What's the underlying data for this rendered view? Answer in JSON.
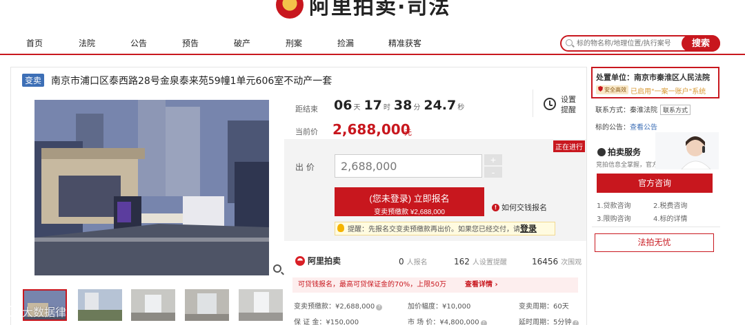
{
  "header": {
    "logo_text": "阿里拍卖·司法",
    "nav": [
      "首页",
      "法院",
      "公告",
      "预告",
      "破产",
      "刑案",
      "捡漏",
      "精准获客"
    ],
    "search_placeholder": "标的物名称/地理位置/执行案号",
    "search_button": "搜索"
  },
  "item": {
    "tag": "变卖",
    "title": "南京市浦口区泰西路28号金泉泰来苑59幢1单元606室不动产一套",
    "countdown_label": "距结束",
    "countdown": {
      "days": "06",
      "days_unit": "天",
      "hours": "17",
      "hours_unit": "时",
      "minutes": "38",
      "minutes_unit": "分",
      "seconds": "24.7",
      "seconds_unit": "秒"
    },
    "current_price_label": "当前价",
    "current_price": "2,688,000",
    "price_unit": "元",
    "remind": "设置提醒",
    "status": "正在进行",
    "bid_label": "出 价",
    "bid_value": "2,688,000",
    "plus": "+",
    "minus": "-",
    "signup_line1": "(您未登录) 立即报名",
    "signup_line2": "变卖预缴款 ¥2,688,000",
    "howto": "如何交钱报名",
    "tip_text": "提醒：先报名交变卖预缴款再出价。如果您已经交付，请",
    "tip_link": "登录"
  },
  "stats": {
    "brand": "阿里拍卖",
    "signups": "0",
    "signups_unit": "人报名",
    "reminders": "162",
    "reminders_unit": "人设置提醒",
    "views": "16456",
    "views_unit": "次围观"
  },
  "deposit_banner": {
    "text": "可贷钱报名，最高可贷保证金的70%，上限50万",
    "link": "查看详情 ›"
  },
  "details": [
    {
      "label": "变卖预缴款：¥2,688,000",
      "q": true
    },
    {
      "label": "加价幅度：¥10,000",
      "q": false
    },
    {
      "label": "变卖周期：60天",
      "q": false
    },
    {
      "label": "保 证 金：¥150,000",
      "q": false
    },
    {
      "label": "市 场 价：¥4,800,000",
      "q": true
    },
    {
      "label": "延时周期：5分钟",
      "q": true
    }
  ],
  "sidebar": {
    "court_label": "处置单位：南京市秦淮区人民法院",
    "safety_badge": "安全高效",
    "court_account": "已启用\"一案一账户\"系统",
    "contact": "联系方式：秦淮法院",
    "contact_btn": "联系方式",
    "notice_label": "标的公告：",
    "notice_link": "查看公告",
    "service_title": "拍卖服务",
    "service_sub": "竞拍信息全掌握，官方服务更放心",
    "consult_btn": "官方咨询",
    "links": [
      "1.贷款咨询",
      "2.税费咨询",
      "3.限购咨询",
      "4.标的详情"
    ],
    "fapai_btn": "法拍无忧"
  },
  "watermark": "大数据律",
  "colors": {
    "brand_red": "#c8171e",
    "tag_blue": "#3d6fb6"
  }
}
